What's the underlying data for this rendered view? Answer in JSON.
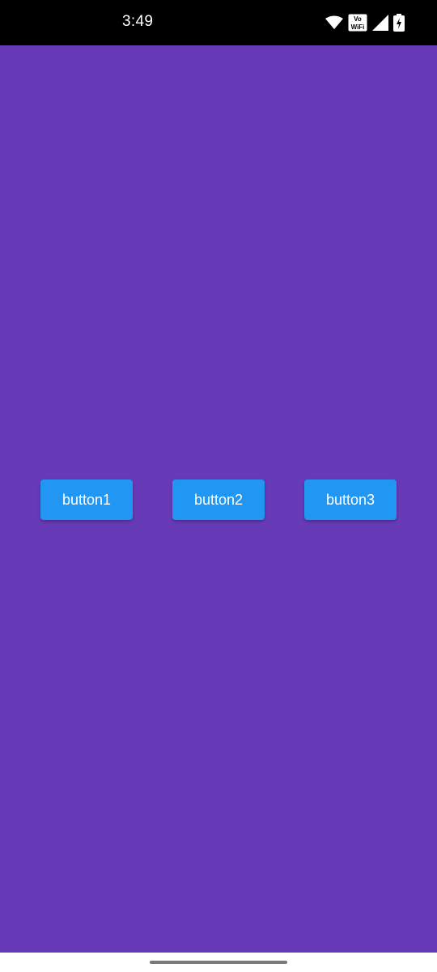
{
  "status_bar": {
    "time": "3:49",
    "volte_top": "Vo",
    "volte_bottom": "WiFi",
    "icons": [
      "wifi-icon",
      "vowifi-icon",
      "cellular-signal-icon",
      "battery-charging-icon"
    ]
  },
  "colors": {
    "background": "#673AB7",
    "button": "#2196F3",
    "button_text": "#FFFFFF",
    "status_bar": "#000000",
    "nav_bar": "#FFFFFF"
  },
  "buttons": [
    {
      "label": "button1"
    },
    {
      "label": "button2"
    },
    {
      "label": "button3"
    }
  ]
}
